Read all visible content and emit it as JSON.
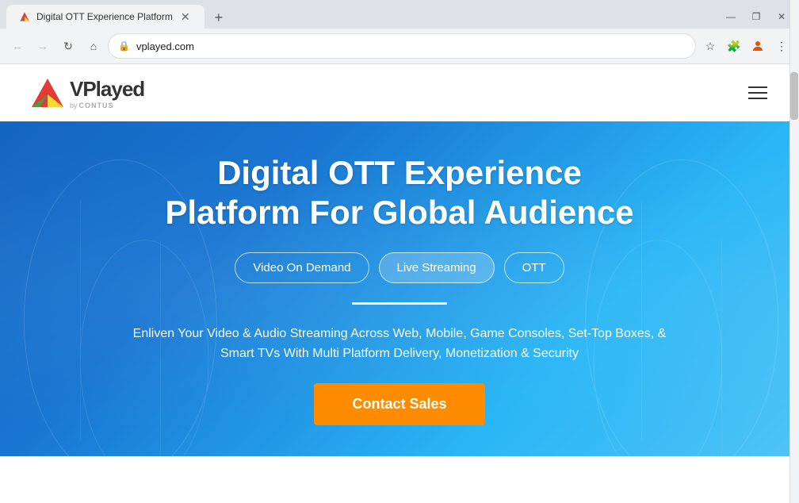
{
  "browser": {
    "tab": {
      "title": "Digital OTT Experience Platform",
      "favicon_alt": "vplayed-favicon"
    },
    "new_tab_icon": "+",
    "window_controls": {
      "minimize": "—",
      "maximize": "❐",
      "close": "✕"
    },
    "toolbar": {
      "back_icon": "←",
      "forward_icon": "→",
      "refresh_icon": "↻",
      "home_icon": "⌂",
      "url": "vplayed.com",
      "bookmark_icon": "☆",
      "extensions_icon": "⧉",
      "profile_icon": "👤",
      "menu_icon": "⋮"
    }
  },
  "navbar": {
    "logo_vplayed": "VPlayed",
    "logo_by": "by",
    "logo_contus": "CONTUS",
    "hamburger_label": "menu"
  },
  "hero": {
    "title_line1": "Digital OTT Experience",
    "title_line2": "Platform For Global Audience",
    "tabs": [
      {
        "label": "Video On Demand",
        "active": false
      },
      {
        "label": "Live Streaming",
        "active": true
      },
      {
        "label": "OTT",
        "active": false
      }
    ],
    "description": "Enliven Your Video & Audio Streaming Across Web, Mobile, Game Consoles, Set-Top Boxes, & Smart TVs With Multi Platform Delivery, Monetization & Security",
    "cta_button": "Contact Sales"
  }
}
